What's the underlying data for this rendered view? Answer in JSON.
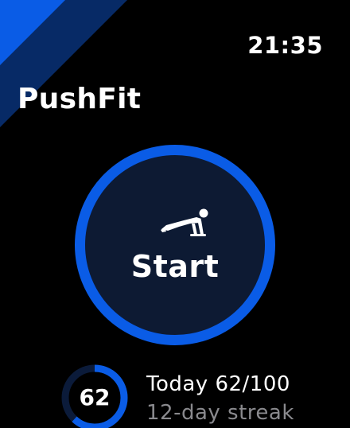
{
  "status": {
    "time": "21:35"
  },
  "app": {
    "title": "PushFit"
  },
  "start": {
    "label": "Start",
    "icon": "pushup-icon"
  },
  "progress": {
    "value_label": "62",
    "current": 62,
    "goal": 100,
    "fraction": 0.62,
    "today": "Today 62/100",
    "streak": "12-day streak"
  },
  "colors": {
    "accent": "#0a5ce6",
    "button_fill": "#0d1a33",
    "stripe_dark": "#072a66",
    "ring_track": "#0b1b3a",
    "secondary_text": "#8a8a8e",
    "background": "#000000"
  }
}
